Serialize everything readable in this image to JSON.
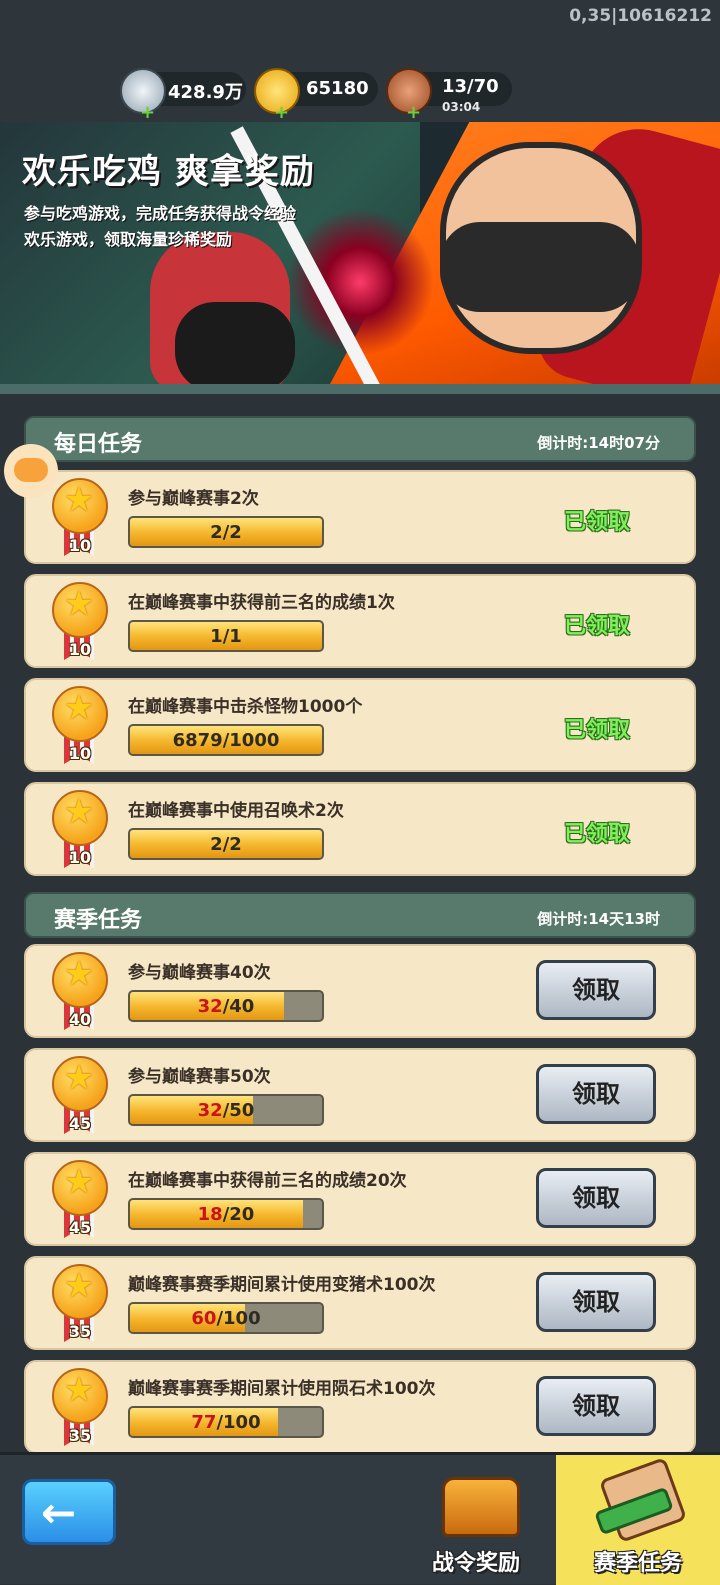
{
  "version": "0,35|10616212",
  "resources": [
    {
      "icon": "silver-coin-icon",
      "value": "428.9万"
    },
    {
      "icon": "gold-ingot-icon",
      "value": "65180"
    },
    {
      "icon": "meat-stamina-icon",
      "value": "13/70",
      "timer": "03:04"
    }
  ],
  "banner": {
    "title": "欢乐吃鸡 爽拿奖励",
    "line1": "参与吃鸡游戏，完成任务获得战令经验",
    "line2": "欢乐游戏，领取海量珍稀奖励"
  },
  "daily": {
    "title": "每日任务",
    "countdown": "倒计时:14时07分",
    "tasks": [
      {
        "xp": "10",
        "desc": "参与巅峰赛事2次",
        "current": "2",
        "total": "2",
        "progress": 1.0,
        "status": "已领取"
      },
      {
        "xp": "10",
        "desc": "在巅峰赛事中获得前三名的成绩1次",
        "current": "1",
        "total": "1",
        "progress": 1.0,
        "status": "已领取"
      },
      {
        "xp": "10",
        "desc": "在巅峰赛事中击杀怪物1000个",
        "current": "6879",
        "total": "1000",
        "progress": 1.0,
        "status": "已领取"
      },
      {
        "xp": "10",
        "desc": "在巅峰赛事中使用召唤术2次",
        "current": "2",
        "total": "2",
        "progress": 1.0,
        "status": "已领取"
      }
    ]
  },
  "season": {
    "title": "赛季任务",
    "countdown": "倒计时:14天13时",
    "tasks": [
      {
        "xp": "40",
        "desc": "参与巅峰赛事40次",
        "current": "32",
        "total": "40",
        "progress": 0.8,
        "button": "领取"
      },
      {
        "xp": "45",
        "desc": "参与巅峰赛事50次",
        "current": "32",
        "total": "50",
        "progress": 0.64,
        "button": "领取"
      },
      {
        "xp": "45",
        "desc": "在巅峰赛事中获得前三名的成绩20次",
        "current": "18",
        "total": "20",
        "progress": 0.9,
        "button": "领取"
      },
      {
        "xp": "35",
        "desc": "巅峰赛事赛季期间累计使用变猪术100次",
        "current": "60",
        "total": "100",
        "progress": 0.6,
        "button": "领取"
      },
      {
        "xp": "35",
        "desc": "巅峰赛事赛季期间累计使用陨石术100次",
        "current": "77",
        "total": "100",
        "progress": 0.77,
        "button": "领取"
      }
    ]
  },
  "bottom": {
    "tab_pass": "战令奖励",
    "tab_season": "赛季任务"
  },
  "colors": {
    "claimed_text": "#7ef05c",
    "progress_current": "#c8141a",
    "active_tab": "#f5e25a"
  }
}
